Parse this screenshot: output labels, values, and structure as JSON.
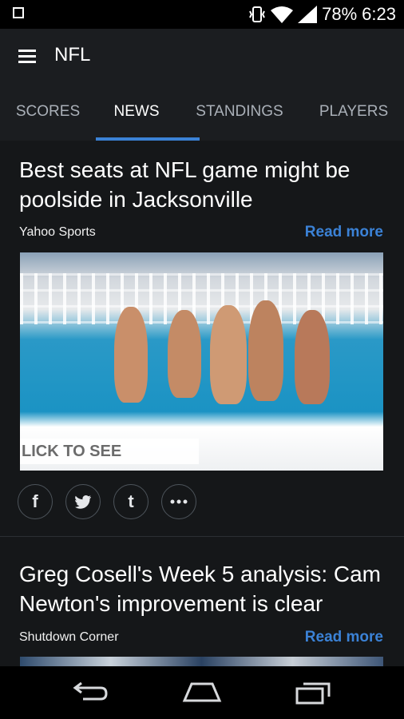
{
  "status": {
    "battery": "78%",
    "time": "6:23"
  },
  "header": {
    "title": "NFL"
  },
  "tabs": [
    {
      "label": "SCORES"
    },
    {
      "label": "NEWS"
    },
    {
      "label": "STANDINGS"
    },
    {
      "label": "PLAYERS"
    }
  ],
  "articles": [
    {
      "title": "Best seats at NFL game might be poolside in Jacksonville",
      "source": "Yahoo Sports",
      "read_more": "Read more",
      "image_overlay": "LICK TO SEE GALLERY"
    },
    {
      "title": "Greg Cosell's Week 5 analysis: Cam Newton's improvement is clear",
      "source": "Shutdown Corner",
      "read_more": "Read more"
    }
  ],
  "share": {
    "icons": [
      "facebook-icon",
      "twitter-icon",
      "tumblr-icon",
      "more-icon"
    ]
  },
  "accent_color": "#3b82d6"
}
